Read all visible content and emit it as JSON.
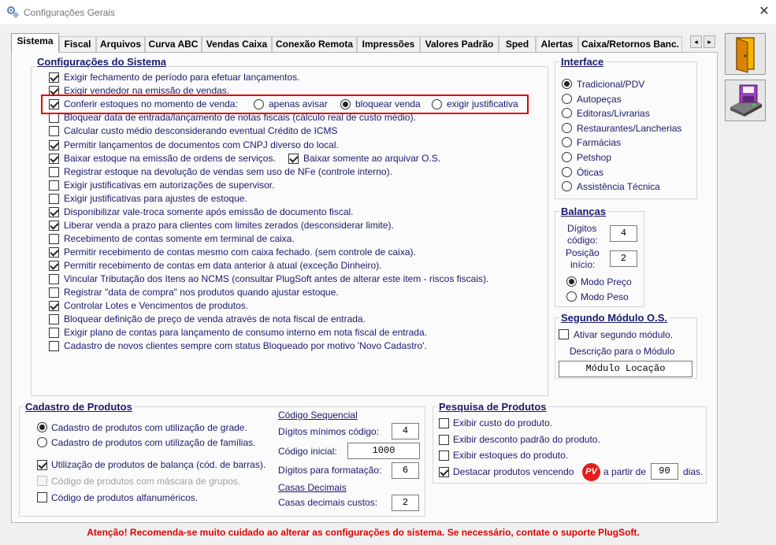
{
  "window": {
    "title": "Configurações Gerais",
    "close_icon": "close-icon",
    "app_icon": "gear-icon"
  },
  "tabs": [
    "Sistema",
    "Fiscal",
    "Arquivos",
    "Curva ABC",
    "Vendas Caixa",
    "Conexão Remota",
    "Impressões",
    "Valores Padrão",
    "Sped",
    "Alertas",
    "Caixa/Retornos Banc."
  ],
  "active_tab": "Sistema",
  "tab_nav": {
    "prev": "◂",
    "next": "▸"
  },
  "config_sistema": {
    "title": "Configurações do Sistema",
    "items": [
      {
        "label": "Exigir fechamento de período para efetuar lançamentos.",
        "checked": true
      },
      {
        "label": "Exigir vendedor na emissão de vendas.",
        "checked": true
      },
      {
        "label": "Conferir estoques no momento de venda:",
        "checked": true
      },
      {
        "label": "Bloquear data de entrada/lançamento de notas fiscais (cálculo real de custo médio).",
        "checked": false
      },
      {
        "label": "Calcular custo médio desconsiderando eventual Crédito de ICMS",
        "checked": false
      },
      {
        "label": "Permitir lançamentos de documentos com CNPJ diverso do local.",
        "checked": true
      },
      {
        "label": "Baixar estoque na emissão de ordens de serviços.",
        "checked": true
      },
      {
        "label": "Registrar estoque na devolução de vendas sem uso de NFe (controle interno).",
        "checked": false
      },
      {
        "label": "Exigir justificativas em autorizações de supervisor.",
        "checked": false
      },
      {
        "label": "Exigir justificativas para ajustes de estoque.",
        "checked": false
      },
      {
        "label": "Disponibilizar vale-troca somente após emissão de documento fiscal.",
        "checked": true
      },
      {
        "label": "Liberar venda a prazo para clientes com limites zerados (desconsiderar limite).",
        "checked": true
      },
      {
        "label": "Recebimento de contas somente em terminal de caixa.",
        "checked": false
      },
      {
        "label": "Permitir recebimento de contas mesmo com caixa fechado. (sem controle de caixa).",
        "checked": true
      },
      {
        "label": "Permitir recebimento de contas em data anterior à atual (exceção Dinheiro).",
        "checked": true
      },
      {
        "label": "Vincular Tributação dos Itens ao NCMS (consultar PlugSoft antes de alterar este item - riscos fiscais).",
        "checked": false
      },
      {
        "label": "Registrar \"data de compra\" nos produtos quando  ajustar estoque.",
        "checked": false
      },
      {
        "label": "Controlar Lotes e Vencimentos de produtos.",
        "checked": true
      },
      {
        "label": "Bloquear definição de preço de venda através de nota fiscal de entrada.",
        "checked": false
      },
      {
        "label": "Exigir plano de contas para lançamento de consumo interno em nota fiscal de entrada.",
        "checked": false
      },
      {
        "label": "Cadastro de novos clientes sempre com status Bloqueado por motivo 'Novo Cadastro'.",
        "checked": false
      }
    ],
    "estoque_options": [
      {
        "label": "apenas avisar",
        "selected": false
      },
      {
        "label": "bloquear venda",
        "selected": true
      },
      {
        "label": "exigir justificativa",
        "selected": false
      }
    ],
    "baixar_arquivar": {
      "label": "Baixar somente ao arquivar O.S.",
      "checked": true
    }
  },
  "interface": {
    "title": "Interface",
    "options": [
      {
        "label": "Tradicional/PDV",
        "selected": true
      },
      {
        "label": "Autopeças",
        "selected": false
      },
      {
        "label": "Editoras/Livrarias",
        "selected": false
      },
      {
        "label": "Restaurantes/Lancherias",
        "selected": false
      },
      {
        "label": "Farmácias",
        "selected": false
      },
      {
        "label": "Petshop",
        "selected": false
      },
      {
        "label": "Óticas",
        "selected": false
      },
      {
        "label": "Assistência Técnica",
        "selected": false
      }
    ]
  },
  "balancas": {
    "title": "Balanças",
    "digitos_label_1": "Dígitos",
    "digitos_label_2": "código:",
    "digitos_value": "4",
    "posicao_label_1": "Posição",
    "posicao_label_2": "início:",
    "posicao_value": "2",
    "modos": [
      {
        "label": "Modo Preço",
        "selected": true
      },
      {
        "label": "Modo Peso",
        "selected": false
      }
    ]
  },
  "segundo_modulo": {
    "title": "Segundo Módulo O.S.",
    "ativar_label": "Ativar segundo módulo.",
    "ativar_checked": false,
    "descricao_label": "Descrição para o Módulo",
    "descricao_value": "Módulo Locação"
  },
  "cadastro_produtos": {
    "title": "Cadastro de Produtos",
    "grade_label": "Cadastro de produtos com utilização de grade.",
    "familias_label": "Cadastro de produtos com utilização de famílias.",
    "grade_selected": true,
    "balanca_label": "Utilização de produtos de balança (cód. de barras).",
    "balanca_checked": true,
    "mascara_label": "Código de produtos com máscara de grupos.",
    "mascara_checked": false,
    "alfanum_label": "Código de produtos alfanuméricos.",
    "alfanum_checked": false,
    "codigo_sequencial_title": "Código Sequencial",
    "digitos_minimos_label": "Dígitos mínimos código:",
    "digitos_minimos_value": "4",
    "codigo_inicial_label": "Código inicial:",
    "codigo_inicial_value": "1000",
    "digitos_formatacao_label": "Dígitos para formatação:",
    "digitos_formatacao_value": "6",
    "casas_decimais_title": "Casas Decimais",
    "casas_custos_label": "Casas decimais custos:",
    "casas_custos_value": "2"
  },
  "pesquisa_produtos": {
    "title": "Pesquisa de Produtos",
    "custo_label": "Exibir custo do produto.",
    "custo_checked": false,
    "desconto_label": "Exibir desconto padrão do produto.",
    "desconto_checked": false,
    "estoques_label": "Exibir estoques do produto.",
    "estoques_checked": false,
    "destacar_label": "Destacar produtos vencendo",
    "destacar_checked": true,
    "pv_badge": "PV",
    "a_partir_label": "a partir de",
    "dias_value": "90",
    "dias_label": "dias."
  },
  "side_buttons": {
    "exit_icon": "exit-door-icon",
    "save_icon": "save-disk-icon"
  },
  "warning": "Atenção! Recomenda-se muito cuidado ao alterar as configurações do sistema. Se necessário, contate o suporte PlugSoft.",
  "colors": {
    "label": "#1a1a6e",
    "warning": "#e00000",
    "highlight": "#e00000"
  }
}
